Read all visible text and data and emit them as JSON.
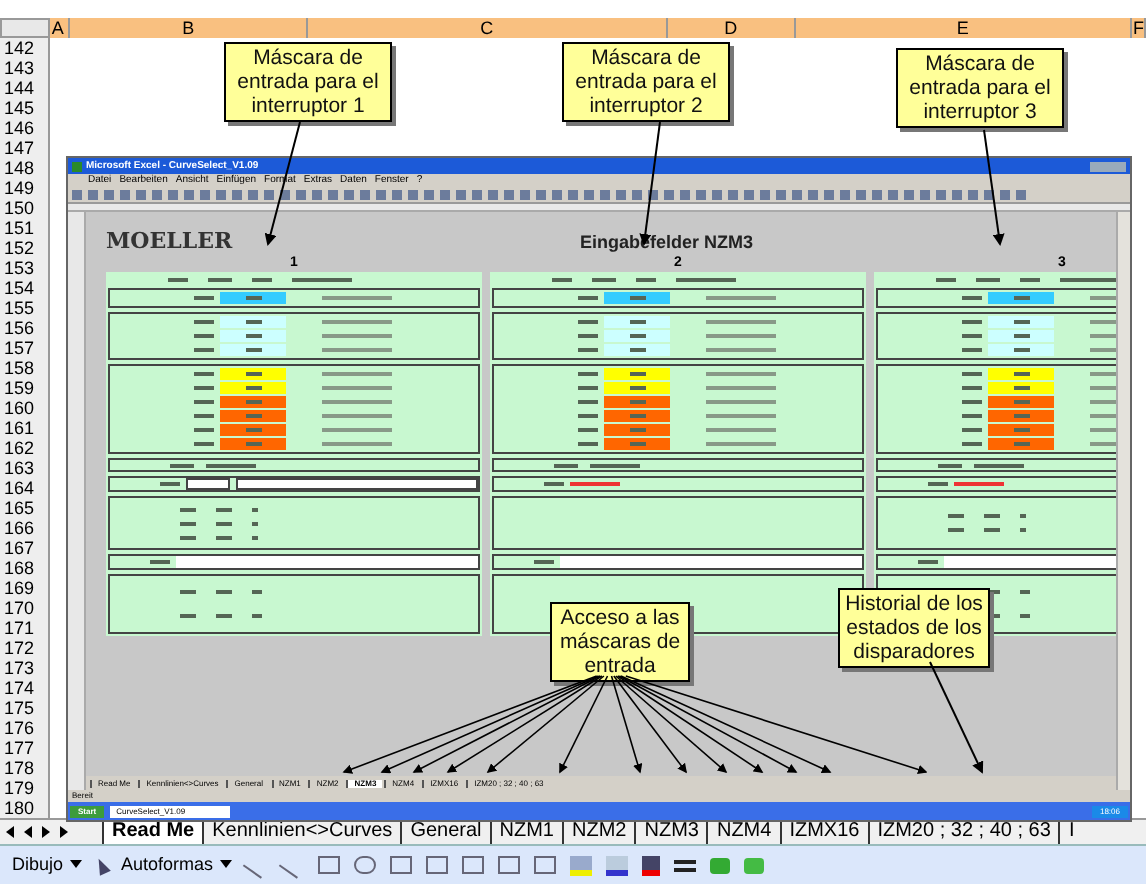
{
  "columns": [
    "A",
    "B",
    "C",
    "D",
    "E",
    "F"
  ],
  "rows": [
    "142",
    "143",
    "144",
    "145",
    "146",
    "147",
    "148",
    "149",
    "150",
    "151",
    "152",
    "153",
    "154",
    "155",
    "156",
    "157",
    "158",
    "159",
    "160",
    "161",
    "162",
    "163",
    "164",
    "165",
    "166",
    "167",
    "168",
    "169",
    "170",
    "171",
    "172",
    "173",
    "174",
    "175",
    "176",
    "177",
    "178",
    "179",
    "180"
  ],
  "callouts": [
    {
      "text": "Máscara de entrada para el interruptor 1"
    },
    {
      "text": "Máscara de entrada para el interruptor 2"
    },
    {
      "text": "Máscara de entrada para el interruptor 3"
    },
    {
      "text": "Acceso a las máscaras de entrada"
    },
    {
      "text": "Historial de los estados de los disparadores"
    }
  ],
  "embedded_window": {
    "title": "Microsoft Excel - CurveSelect_V1.09",
    "menu": [
      "Datei",
      "Bearbeiten",
      "Ansicht",
      "Einfügen",
      "Format",
      "Extras",
      "Daten",
      "Fenster",
      "?"
    ],
    "logo": "MOELLER",
    "heading": "Eingabefelder NZM3",
    "panels": [
      {
        "number": "1",
        "sections": [
          [
            {
              "color": "#33ccff"
            }
          ],
          [
            {
              "color": "#ccffff"
            },
            {
              "color": "#ccffff"
            },
            {
              "color": "#ccffff"
            }
          ],
          [
            {
              "color": "#ffff00"
            },
            {
              "color": "#ffff00"
            },
            {
              "color": "#ff6600"
            },
            {
              "color": "#ff6600"
            },
            {
              "color": "#ff6600"
            },
            {
              "color": "#ff6600"
            }
          ]
        ],
        "error": {
          "kind": "fields"
        },
        "control_rows": [
          {
            "kind": "reading"
          },
          {
            "kind": "reading"
          },
          {
            "kind": "reading"
          }
        ],
        "limit_rows": [
          {
            "kind": "reading"
          },
          {
            "kind": "reading"
          }
        ]
      },
      {
        "number": "2",
        "sections": [
          [
            {
              "color": "#33ccff"
            }
          ],
          [
            {
              "color": "#ccffff"
            },
            {
              "color": "#ccffff"
            },
            {
              "color": "#ccffff"
            }
          ],
          [
            {
              "color": "#ffff00"
            },
            {
              "color": "#ffff00"
            },
            {
              "color": "#ff6600"
            },
            {
              "color": "#ff6600"
            },
            {
              "color": "#ff6600"
            },
            {
              "color": "#ff6600"
            }
          ]
        ],
        "error": {
          "kind": "message"
        }
      },
      {
        "number": "3",
        "sections": [
          [
            {
              "color": "#33ccff"
            }
          ],
          [
            {
              "color": "#ccffff"
            },
            {
              "color": "#ccffff"
            },
            {
              "color": "#ccffff"
            }
          ],
          [
            {
              "color": "#ffff00"
            },
            {
              "color": "#ffff00"
            },
            {
              "color": "#ff6600"
            },
            {
              "color": "#ff6600"
            },
            {
              "color": "#ff6600"
            },
            {
              "color": "#ff6600"
            }
          ]
        ],
        "error": {
          "kind": "message"
        },
        "control_rows": [
          {
            "kind": "reading"
          },
          {
            "kind": "reading"
          }
        ],
        "limit_rows": [
          {
            "kind": "reading"
          },
          {
            "kind": "reading"
          }
        ]
      }
    ],
    "tabs": [
      {
        "label": "Read Me",
        "selected": false
      },
      {
        "label": "Kennlinien<>Curves",
        "selected": false
      },
      {
        "label": "General",
        "selected": false
      },
      {
        "label": "NZM1",
        "selected": false
      },
      {
        "label": "NZM2",
        "selected": false
      },
      {
        "label": "NZM3",
        "selected": true
      },
      {
        "label": "NZM4",
        "selected": false
      },
      {
        "label": "IZMX16",
        "selected": false
      },
      {
        "label": "IZM20 ; 32 ; 40 ; 63",
        "selected": false
      }
    ],
    "status": "Bereit",
    "start": "Start",
    "task": "CurveSelect_V1.09",
    "clock": "18:06"
  },
  "tabs": [
    {
      "label": "Read Me",
      "selected": true
    },
    {
      "label": "Kennlinien<>Curves",
      "selected": false
    },
    {
      "label": "General",
      "selected": false
    },
    {
      "label": "NZM1",
      "selected": false
    },
    {
      "label": "NZM2",
      "selected": false
    },
    {
      "label": "NZM3",
      "selected": false
    },
    {
      "label": "NZM4",
      "selected": false
    },
    {
      "label": "IZMX16",
      "selected": false
    },
    {
      "label": "IZM20 ; 32 ; 40 ; 63",
      "selected": false
    },
    {
      "label": "I",
      "selected": false
    }
  ],
  "drawing_toolbar": {
    "draw_menu": "Dibujo",
    "autoshapes_menu": "Autoformas"
  }
}
